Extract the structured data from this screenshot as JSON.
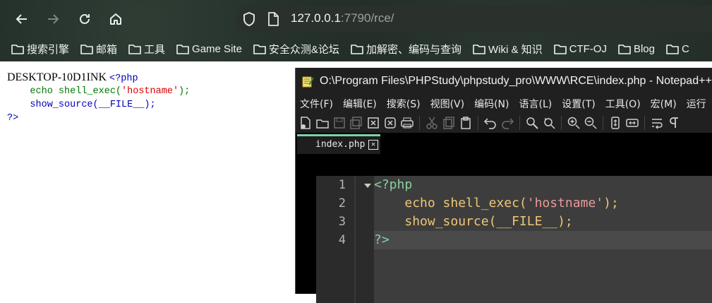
{
  "browser": {
    "url_host": "127.0.0.1",
    "url_rest": ":7790/rce/",
    "bookmarks": [
      "搜索引擎",
      "邮箱",
      "工具",
      "Game Site",
      "安全众测&论坛",
      "加解密、编码与查询",
      "Wiki & 知识",
      "CTF-OJ",
      "Blog",
      "C"
    ]
  },
  "page": {
    "hostname_output": "DESKTOP-10D1INK",
    "src": {
      "open_tag": "<?php",
      "line2_func": "echo shell_exec(",
      "line2_str": "'hostname'",
      "line2_end": ");",
      "line3": "show_source(__FILE__);",
      "close_tag": "?>"
    }
  },
  "notepad": {
    "title": "O:\\Program Files\\PHPStudy\\phpstudy_pro\\WWW\\RCE\\index.php - Notepad++",
    "menu": [
      "文件(F)",
      "编辑(E)",
      "搜索(S)",
      "视图(V)",
      "编码(N)",
      "语言(L)",
      "设置(T)",
      "工具(O)",
      "宏(M)",
      "运行"
    ],
    "tab_name": "index.php",
    "tab_close": "✕",
    "line_numbers": [
      "1",
      "2",
      "3",
      "4"
    ],
    "code": {
      "l1": "<?php",
      "l2_indent": "    ",
      "l2_func": "echo shell_exec(",
      "l2_str": "'hostname'",
      "l2_end": ");",
      "l3_indent": "    ",
      "l3": "show_source(__FILE__);",
      "l4": "?>"
    }
  }
}
